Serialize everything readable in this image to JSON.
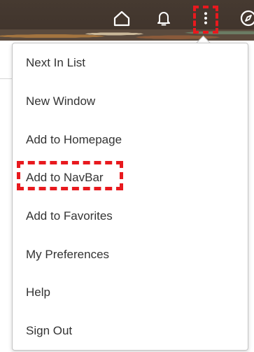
{
  "header": {
    "icons": [
      "home-icon",
      "bell-icon",
      "vertical-dots-icon",
      "compass-icon"
    ]
  },
  "menu": {
    "items": [
      {
        "label": "Next In List"
      },
      {
        "label": "New Window"
      },
      {
        "label": "Add to Homepage"
      },
      {
        "label": "Add to NavBar"
      },
      {
        "label": "Add to Favorites"
      },
      {
        "label": "My Preferences"
      },
      {
        "label": "Help"
      },
      {
        "label": "Sign Out"
      }
    ]
  },
  "colors": {
    "header_bg": "#463a31",
    "highlight": "#e8191e",
    "menu_text": "#333333",
    "menu_border": "#c4c4c4"
  }
}
